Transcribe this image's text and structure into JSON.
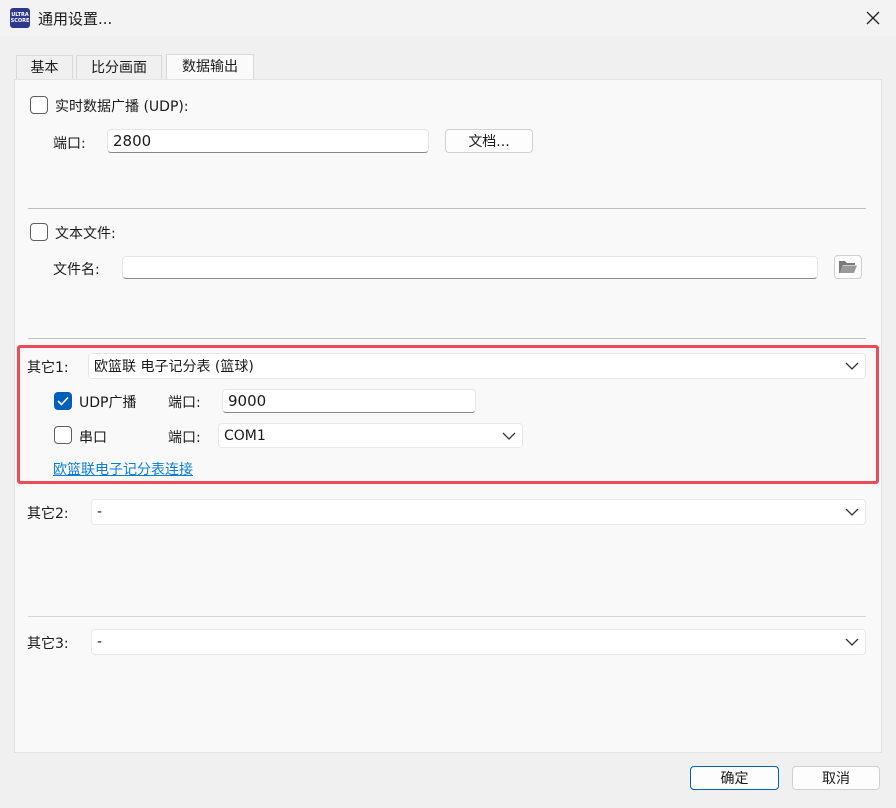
{
  "window": {
    "title": "通用设置...",
    "icon_text_line1": "ULTRA",
    "icon_text_line2": "SCORE"
  },
  "tabs": [
    {
      "label": "基本",
      "active": false
    },
    {
      "label": "比分画面",
      "active": false
    },
    {
      "label": "数据输出",
      "active": true
    }
  ],
  "udp_broadcast": {
    "label": "实时数据广播 (UDP):",
    "checked": false,
    "port_label": "端口:",
    "port_value": "2800",
    "doc_button": "文档..."
  },
  "text_file": {
    "label": "文本文件:",
    "checked": false,
    "filename_label": "文件名:",
    "filename_value": ""
  },
  "other1": {
    "label": "其它1:",
    "selected": "欧篮联 电子记分表 (篮球)",
    "udp_label": "UDP广播",
    "udp_checked": true,
    "udp_port_label": "端口:",
    "udp_port_value": "9000",
    "serial_label": "串口",
    "serial_checked": false,
    "serial_port_label": "端口:",
    "serial_port_value": "COM1",
    "link_text": "欧篮联电子记分表连接"
  },
  "other2": {
    "label": "其它2:",
    "selected": "-"
  },
  "other3": {
    "label": "其它3:",
    "selected": "-"
  },
  "footer": {
    "ok_label": "确定",
    "cancel_label": "取消"
  },
  "colors": {
    "accent": "#005fb8",
    "highlight": "#ee4b57",
    "link": "#0a7ed6"
  }
}
